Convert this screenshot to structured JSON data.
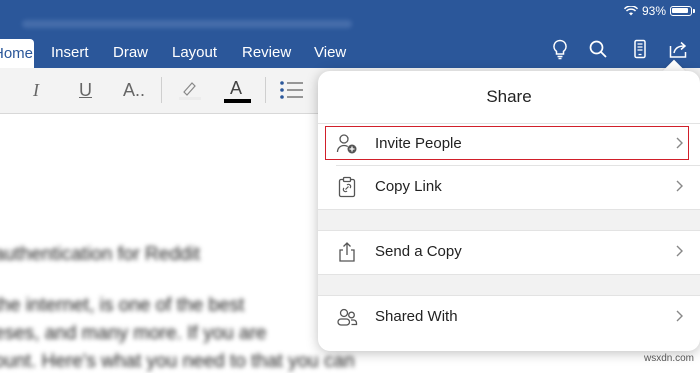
{
  "status": {
    "battery": "93%"
  },
  "tabs": [
    {
      "label": "Home"
    },
    {
      "label": "Insert"
    },
    {
      "label": "Draw"
    },
    {
      "label": "Layout"
    },
    {
      "label": "Review"
    },
    {
      "label": "View"
    }
  ],
  "ribbon": {
    "italic": "I",
    "underline": "U",
    "font_size": "A..",
    "font_color": "A"
  },
  "document": {
    "lines": [
      "authentication for Reddit",
      "the internet, is one of the best",
      "eses, and many more. If you are",
      "ount. Here's what you need to that you can"
    ]
  },
  "share": {
    "title": "Share",
    "items": [
      {
        "label": "Invite People",
        "icon": "add-person-icon"
      },
      {
        "label": "Copy Link",
        "icon": "clipboard-link-icon"
      },
      {
        "label": "Send a Copy",
        "icon": "share-upload-icon"
      },
      {
        "label": "Shared With",
        "icon": "people-icon"
      }
    ]
  },
  "colors": {
    "accent": "#2b579a",
    "highlight": "#d11f2a"
  },
  "watermark": "wsxdn.com"
}
